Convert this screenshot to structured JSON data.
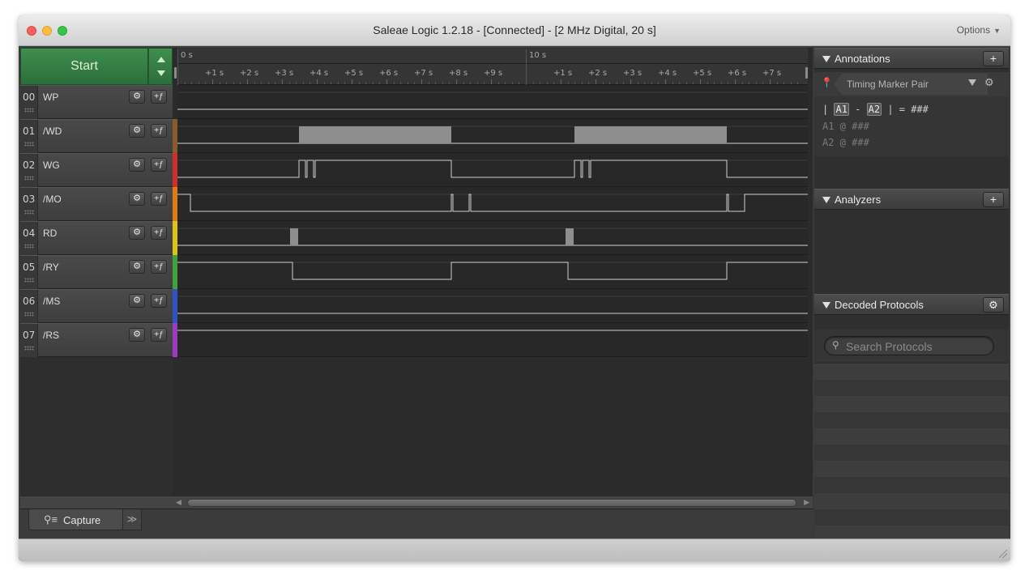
{
  "window": {
    "title": "Saleae Logic 1.2.18 - [Connected] - [2 MHz Digital, 20 s]",
    "options_label": "Options"
  },
  "capture_controls": {
    "start_label": "Start"
  },
  "channels": [
    {
      "num": "00",
      "name": "WP",
      "color": "#2a2a2a"
    },
    {
      "num": "01",
      "name": "/WD",
      "color": "#8a5a2b"
    },
    {
      "num": "02",
      "name": "WG",
      "color": "#d12d2d"
    },
    {
      "num": "03",
      "name": "/MO",
      "color": "#e07a14"
    },
    {
      "num": "04",
      "name": "RD",
      "color": "#e0c414"
    },
    {
      "num": "05",
      "name": "/RY",
      "color": "#3fa23a"
    },
    {
      "num": "06",
      "name": "/MS",
      "color": "#3251c4"
    },
    {
      "num": "07",
      "name": "/RS",
      "color": "#9b3bc4"
    }
  ],
  "channel_buttons": {
    "settings_glyph": "⚙",
    "trigger_glyph": "+ƒ"
  },
  "ruler": {
    "major_labels": [
      "0 s",
      "10 s"
    ],
    "minor_labels_a": [
      "+1 s",
      "+2 s",
      "+3 s",
      "+4 s",
      "+5 s",
      "+6 s",
      "+7 s",
      "+8 s",
      "+9 s"
    ],
    "minor_labels_b": [
      "+1 s",
      "+2 s",
      "+3 s",
      "+4 s",
      "+5 s",
      "+6 s",
      "+7 s"
    ]
  },
  "tabs": {
    "capture_label": "Capture",
    "more_glyph": "≫"
  },
  "annotations": {
    "title": "Annotations",
    "add_glyph": "+",
    "marker_type": "Timing Marker Pair",
    "line1_prefix": "|",
    "a1": "A1",
    "dash": "-",
    "a2": "A2",
    "line1_suffix": "| = ###",
    "line2": "A1  @  ###",
    "line3": "A2  @  ###"
  },
  "analyzers": {
    "title": "Analyzers",
    "add_glyph": "+"
  },
  "decoded_protocols": {
    "title": "Decoded Protocols",
    "search_placeholder": "Search Protocols"
  },
  "colors": {
    "start_green": "#2f7a3f",
    "trace": "#d0d0d0",
    "burst_fill": "#8e8e8e"
  }
}
